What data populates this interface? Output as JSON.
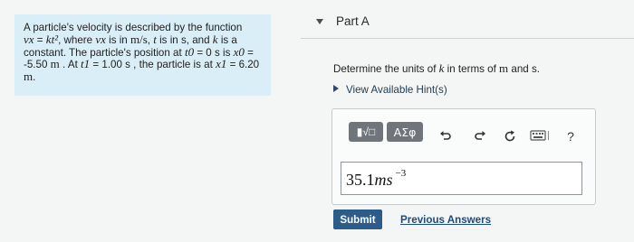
{
  "problem": {
    "line1": "A particle's velocity is described by the function",
    "vx_lhs": "vx",
    "eq": "=",
    "vx_rhs": "kt²",
    "line2a": ", where",
    "vx2": "vx",
    "line2b": "is in",
    "unit_ms": "m/s",
    "line2c": ",",
    "t": "t",
    "line2d": "is in",
    "unit_s": "s",
    "line2e": ", and",
    "k": "k",
    "line2f": "is a",
    "line3": "constant. The particle's position at",
    "t0": "t0",
    "line3b": "= 0 s is",
    "x0": "x0",
    "line3c": "=",
    "line4a": "-5.50",
    "unit_m1": "m",
    "line4b": ". At",
    "t1": "t1",
    "line4c": "= 1.00 s , the particle is at",
    "x1": "x1",
    "line4d": "= 6.20",
    "unit_m2": "m",
    "line5": "."
  },
  "part": {
    "title": "Part A"
  },
  "question": {
    "text_a": "Determine the units of",
    "k": "k",
    "text_b": "in terms of",
    "m": "m",
    "text_c": "and s."
  },
  "hints": {
    "label": "View Available Hint(s)"
  },
  "toolbar": {
    "templates_label": "▮√□",
    "symbols_label": "ΑΣφ",
    "undo_icon": "undo-icon",
    "redo_icon": "redo-icon",
    "reset_icon": "reset-icon",
    "keyboard_icon": "keyboard-icon",
    "help_label": "?"
  },
  "answer": {
    "number": "35.1",
    "unit": "ms",
    "exponent": "−3"
  },
  "actions": {
    "submit_label": "Submit",
    "previous_answers_label": "Previous Answers"
  }
}
